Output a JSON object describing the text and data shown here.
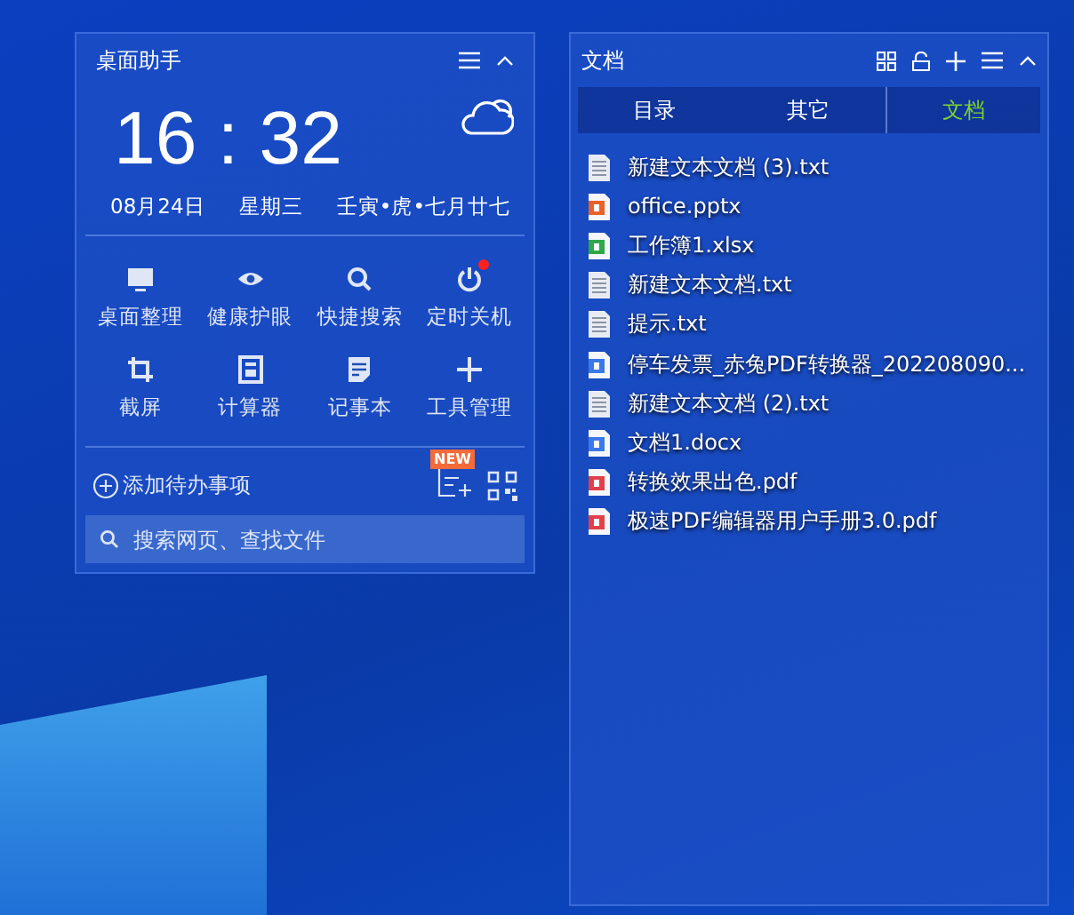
{
  "assistant": {
    "title": "桌面助手",
    "time": "16 : 32",
    "date": "08月24日",
    "weekday": "星期三",
    "lunar": "壬寅•虎•七月廿七",
    "tools": [
      {
        "kind": "monitor",
        "label": "桌面整理",
        "dot": false
      },
      {
        "kind": "eye",
        "label": "健康护眼",
        "dot": false
      },
      {
        "kind": "search",
        "label": "快捷搜索",
        "dot": false
      },
      {
        "kind": "power",
        "label": "定时关机",
        "dot": true
      },
      {
        "kind": "crop",
        "label": "截屏",
        "dot": false
      },
      {
        "kind": "calculator",
        "label": "计算器",
        "dot": false
      },
      {
        "kind": "note",
        "label": "记事本",
        "dot": false
      },
      {
        "kind": "plus",
        "label": "工具管理",
        "dot": false
      }
    ],
    "todo": "添加待办事项",
    "new_badge": "NEW",
    "search": {
      "placeholder": "搜索网页、查找文件"
    }
  },
  "documents": {
    "title": "文档",
    "tabs": [
      {
        "label": "目录",
        "selected": false
      },
      {
        "label": "其它",
        "selected": false
      },
      {
        "label": "文档",
        "selected": true
      }
    ],
    "files": [
      {
        "kind": "txt",
        "name": "新建文本文档 (3).txt"
      },
      {
        "kind": "pptx",
        "name": "office.pptx"
      },
      {
        "kind": "xlsx",
        "name": "工作簿1.xlsx"
      },
      {
        "kind": "txt",
        "name": "新建文本文档.txt"
      },
      {
        "kind": "txt",
        "name": "提示.txt"
      },
      {
        "kind": "docx",
        "name": "停车发票_赤兔PDF转换器_202208090..."
      },
      {
        "kind": "txt",
        "name": "新建文本文档 (2).txt"
      },
      {
        "kind": "docx",
        "name": "文档1.docx"
      },
      {
        "kind": "pdf",
        "name": "转换效果出色.pdf"
      },
      {
        "kind": "pdf",
        "name": "极速PDF编辑器用户手册3.0.pdf"
      }
    ]
  }
}
